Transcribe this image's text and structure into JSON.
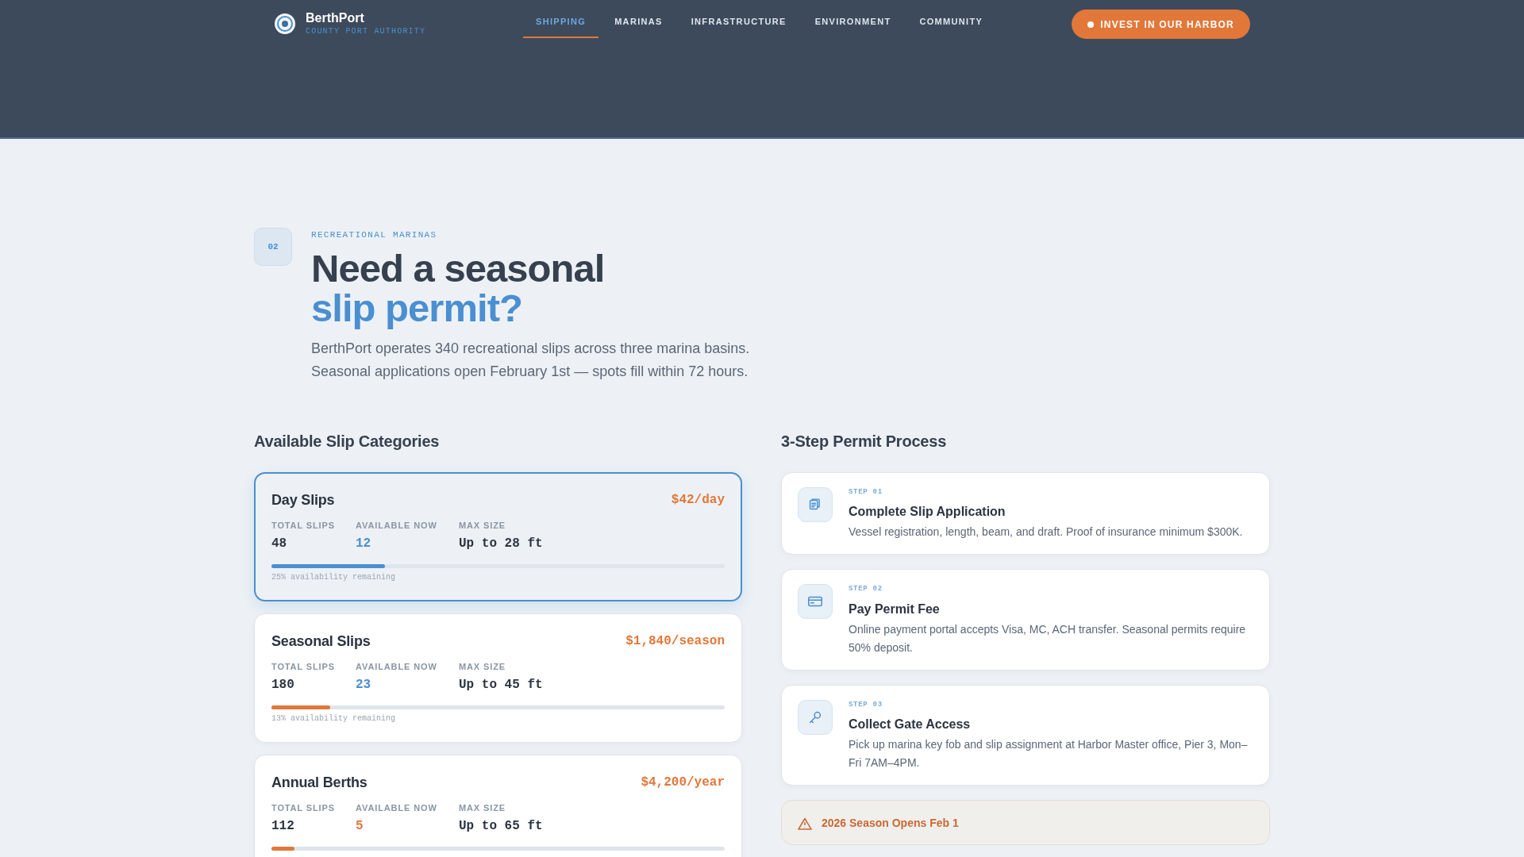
{
  "brand": {
    "name": "BerthPort",
    "tagline": "COUNTY PORT AUTHORITY"
  },
  "nav": [
    {
      "label": "SHIPPING",
      "selected": true
    },
    {
      "label": "MARINAS",
      "selected": false
    },
    {
      "label": "INFRASTRUCTURE",
      "selected": false
    },
    {
      "label": "ENVIRONMENT",
      "selected": false
    },
    {
      "label": "COMMUNITY",
      "selected": false
    }
  ],
  "cta": "INVEST IN OUR HARBOR",
  "section": {
    "number": "02",
    "eyebrow": "RECREATIONAL MARINAS",
    "title": "Need a seasonal",
    "title_accent": "slip permit?",
    "lines": [
      "BerthPort operates 340 recreational slips across three marina basins.",
      "Seasonal applications open February 1st — spots fill within 72 hours."
    ]
  },
  "slips": {
    "heading": "Available Slip Categories",
    "cards": [
      {
        "name": "Day Slips",
        "price": "$42/day",
        "selected": true,
        "stats": [
          {
            "label": "TOTAL SLIPS",
            "value": "48"
          },
          {
            "label": "AVAILABLE NOW",
            "value": "12"
          },
          {
            "label": "MAX SIZE",
            "value": "Up to 28 ft"
          }
        ],
        "level": 0.25,
        "caption": "25% availability remaining"
      },
      {
        "name": "Seasonal Slips",
        "price": "$1,840/season",
        "selected": false,
        "stats": [
          {
            "label": "TOTAL SLIPS",
            "value": "180"
          },
          {
            "label": "AVAILABLE NOW",
            "value": "23"
          },
          {
            "label": "MAX SIZE",
            "value": "Up to 45 ft"
          }
        ],
        "level": 0.13,
        "caption": "13% availability remaining"
      },
      {
        "name": "Annual Berths",
        "price": "$4,200/year",
        "selected": false,
        "stats": [
          {
            "label": "TOTAL SLIPS",
            "value": "112"
          },
          {
            "label": "AVAILABLE NOW",
            "value": "5"
          },
          {
            "label": "MAX SIZE",
            "value": "Up to 65 ft"
          }
        ],
        "level": 0.05
      }
    ]
  },
  "process": {
    "heading": "3-Step Permit Process",
    "steps": [
      {
        "step": "STEP 01",
        "title": "Complete Slip Application",
        "text": "Vessel registration, length, beam, and draft. Proof of insurance minimum $300K."
      },
      {
        "step": "STEP 02",
        "title": "Pay Permit Fee",
        "text": "Online payment portal accepts Visa, MC, ACH transfer. Seasonal permits require 50% deposit."
      },
      {
        "step": "STEP 03",
        "title": "Collect Gate Access",
        "text": "Pick up marina key fob and slip assignment at Harbor Master office, Pier 3, Mon–Fri 7AM–4PM."
      }
    ],
    "notice": "2026 Season Opens Feb 1"
  }
}
